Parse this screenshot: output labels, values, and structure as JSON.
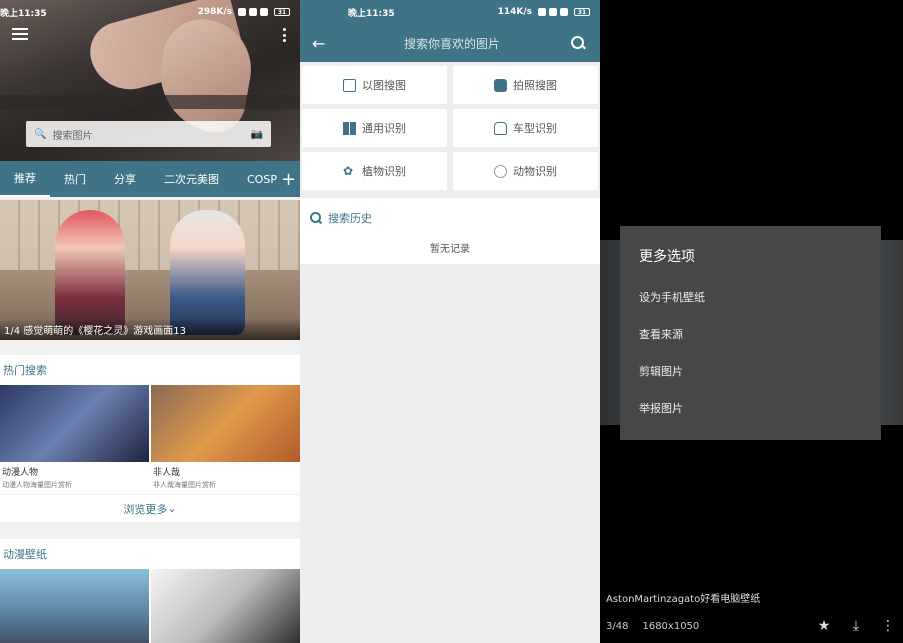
{
  "panel1": {
    "status": {
      "time": "晚上11:35",
      "speed": "298K/s",
      "battery": "31"
    },
    "search_placeholder": "搜索图片",
    "tabs": [
      "推荐",
      "热门",
      "分享",
      "二次元美图",
      "COSP"
    ],
    "banner_caption": "1/4  感觉萌萌的《樱花之灵》游戏画面13",
    "hot_search": {
      "title": "热门搜索",
      "items": [
        {
          "name": "动漫人物",
          "desc": "动漫人物海量图片赏析",
          "color": "#3a4b70"
        },
        {
          "name": "非人哉",
          "desc": "非人哉海量图片赏析",
          "color": "#d78a3d"
        }
      ],
      "more": "浏览更多"
    },
    "wallpaper": {
      "title": "动漫壁纸"
    }
  },
  "panel2": {
    "status": {
      "time": "晚上11:35",
      "speed": "114K/s",
      "battery": "31"
    },
    "search_placeholder": "搜索你喜欢的图片",
    "buttons": [
      {
        "label": "以图搜图",
        "icon": "image-icon"
      },
      {
        "label": "拍照搜图",
        "icon": "camera-icon"
      },
      {
        "label": "通用识别",
        "icon": "grid-icon"
      },
      {
        "label": "车型识别",
        "icon": "car-icon"
      },
      {
        "label": "植物识别",
        "icon": "plant-icon"
      },
      {
        "label": "动物识别",
        "icon": "animal-icon"
      }
    ],
    "history_title": "搜索历史",
    "history_empty": "暂无记录"
  },
  "panel3": {
    "menu_title": "更多选项",
    "menu_items": [
      "设为手机壁纸",
      "查看来源",
      "剪辑图片",
      "举报图片"
    ],
    "caption": "AstonMartinzagato好看电脑壁纸",
    "index": "3/48",
    "resolution": "1680x1050"
  },
  "colors": {
    "accent": "#3f7486",
    "menu_bg": "#474747"
  }
}
